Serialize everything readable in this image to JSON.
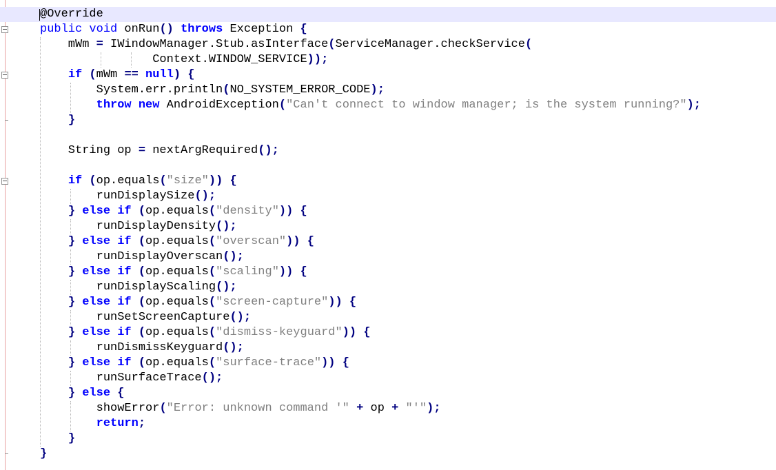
{
  "editor": {
    "lines": [
      [
        [
          "an",
          "@Override"
        ]
      ],
      [
        [
          "kw",
          "public"
        ],
        [
          "pl",
          " "
        ],
        [
          "kw",
          "void"
        ],
        [
          "pl",
          " onRun"
        ],
        [
          "op",
          "()"
        ],
        [
          "pl",
          " "
        ],
        [
          "kwb",
          "throws"
        ],
        [
          "pl",
          " Exception "
        ],
        [
          "op",
          "{"
        ]
      ],
      [
        [
          "pl",
          "    mWm "
        ],
        [
          "op",
          "="
        ],
        [
          "pl",
          " IWindowManager.Stub.asInterface"
        ],
        [
          "op",
          "("
        ],
        [
          "pl",
          "ServiceManager.checkService"
        ],
        [
          "op",
          "("
        ]
      ],
      [
        [
          "pl",
          "                Context.WINDOW_SERVICE"
        ],
        [
          "op",
          "));"
        ]
      ],
      [
        [
          "pl",
          "    "
        ],
        [
          "kwb",
          "if"
        ],
        [
          "pl",
          " "
        ],
        [
          "op",
          "("
        ],
        [
          "pl",
          "mWm "
        ],
        [
          "op",
          "=="
        ],
        [
          "pl",
          " "
        ],
        [
          "kwb",
          "null"
        ],
        [
          "op",
          ")"
        ],
        [
          "pl",
          " "
        ],
        [
          "op",
          "{"
        ]
      ],
      [
        [
          "pl",
          "        System.err.println"
        ],
        [
          "op",
          "("
        ],
        [
          "pl",
          "NO_SYSTEM_ERROR_CODE"
        ],
        [
          "op",
          ");"
        ]
      ],
      [
        [
          "pl",
          "        "
        ],
        [
          "kwb",
          "throw"
        ],
        [
          "pl",
          " "
        ],
        [
          "kwb",
          "new"
        ],
        [
          "pl",
          " AndroidException"
        ],
        [
          "op",
          "("
        ],
        [
          "str",
          "\"Can't connect to window manager; is the system running?\""
        ],
        [
          "op",
          ");"
        ]
      ],
      [
        [
          "pl",
          "    "
        ],
        [
          "op",
          "}"
        ]
      ],
      [],
      [
        [
          "pl",
          "    String op "
        ],
        [
          "op",
          "="
        ],
        [
          "pl",
          " nextArgRequired"
        ],
        [
          "op",
          "();"
        ]
      ],
      [],
      [
        [
          "pl",
          "    "
        ],
        [
          "kwb",
          "if"
        ],
        [
          "pl",
          " "
        ],
        [
          "op",
          "("
        ],
        [
          "pl",
          "op.equals"
        ],
        [
          "op",
          "("
        ],
        [
          "str",
          "\"size\""
        ],
        [
          "op",
          "))"
        ],
        [
          "pl",
          " "
        ],
        [
          "op",
          "{"
        ]
      ],
      [
        [
          "pl",
          "        runDisplaySize"
        ],
        [
          "op",
          "();"
        ]
      ],
      [
        [
          "pl",
          "    "
        ],
        [
          "op",
          "}"
        ],
        [
          "pl",
          " "
        ],
        [
          "kwb",
          "else"
        ],
        [
          "pl",
          " "
        ],
        [
          "kwb",
          "if"
        ],
        [
          "pl",
          " "
        ],
        [
          "op",
          "("
        ],
        [
          "pl",
          "op.equals"
        ],
        [
          "op",
          "("
        ],
        [
          "str",
          "\"density\""
        ],
        [
          "op",
          "))"
        ],
        [
          "pl",
          " "
        ],
        [
          "op",
          "{"
        ]
      ],
      [
        [
          "pl",
          "        runDisplayDensity"
        ],
        [
          "op",
          "();"
        ]
      ],
      [
        [
          "pl",
          "    "
        ],
        [
          "op",
          "}"
        ],
        [
          "pl",
          " "
        ],
        [
          "kwb",
          "else"
        ],
        [
          "pl",
          " "
        ],
        [
          "kwb",
          "if"
        ],
        [
          "pl",
          " "
        ],
        [
          "op",
          "("
        ],
        [
          "pl",
          "op.equals"
        ],
        [
          "op",
          "("
        ],
        [
          "str",
          "\"overscan\""
        ],
        [
          "op",
          "))"
        ],
        [
          "pl",
          " "
        ],
        [
          "op",
          "{"
        ]
      ],
      [
        [
          "pl",
          "        runDisplayOverscan"
        ],
        [
          "op",
          "();"
        ]
      ],
      [
        [
          "pl",
          "    "
        ],
        [
          "op",
          "}"
        ],
        [
          "pl",
          " "
        ],
        [
          "kwb",
          "else"
        ],
        [
          "pl",
          " "
        ],
        [
          "kwb",
          "if"
        ],
        [
          "pl",
          " "
        ],
        [
          "op",
          "("
        ],
        [
          "pl",
          "op.equals"
        ],
        [
          "op",
          "("
        ],
        [
          "str",
          "\"scaling\""
        ],
        [
          "op",
          "))"
        ],
        [
          "pl",
          " "
        ],
        [
          "op",
          "{"
        ]
      ],
      [
        [
          "pl",
          "        runDisplayScaling"
        ],
        [
          "op",
          "();"
        ]
      ],
      [
        [
          "pl",
          "    "
        ],
        [
          "op",
          "}"
        ],
        [
          "pl",
          " "
        ],
        [
          "kwb",
          "else"
        ],
        [
          "pl",
          " "
        ],
        [
          "kwb",
          "if"
        ],
        [
          "pl",
          " "
        ],
        [
          "op",
          "("
        ],
        [
          "pl",
          "op.equals"
        ],
        [
          "op",
          "("
        ],
        [
          "str",
          "\"screen-capture\""
        ],
        [
          "op",
          "))"
        ],
        [
          "pl",
          " "
        ],
        [
          "op",
          "{"
        ]
      ],
      [
        [
          "pl",
          "        runSetScreenCapture"
        ],
        [
          "op",
          "();"
        ]
      ],
      [
        [
          "pl",
          "    "
        ],
        [
          "op",
          "}"
        ],
        [
          "pl",
          " "
        ],
        [
          "kwb",
          "else"
        ],
        [
          "pl",
          " "
        ],
        [
          "kwb",
          "if"
        ],
        [
          "pl",
          " "
        ],
        [
          "op",
          "("
        ],
        [
          "pl",
          "op.equals"
        ],
        [
          "op",
          "("
        ],
        [
          "str",
          "\"dismiss-keyguard\""
        ],
        [
          "op",
          "))"
        ],
        [
          "pl",
          " "
        ],
        [
          "op",
          "{"
        ]
      ],
      [
        [
          "pl",
          "        runDismissKeyguard"
        ],
        [
          "op",
          "();"
        ]
      ],
      [
        [
          "pl",
          "    "
        ],
        [
          "op",
          "}"
        ],
        [
          "pl",
          " "
        ],
        [
          "kwb",
          "else"
        ],
        [
          "pl",
          " "
        ],
        [
          "kwb",
          "if"
        ],
        [
          "pl",
          " "
        ],
        [
          "op",
          "("
        ],
        [
          "pl",
          "op.equals"
        ],
        [
          "op",
          "("
        ],
        [
          "str",
          "\"surface-trace\""
        ],
        [
          "op",
          "))"
        ],
        [
          "pl",
          " "
        ],
        [
          "op",
          "{"
        ]
      ],
      [
        [
          "pl",
          "        runSurfaceTrace"
        ],
        [
          "op",
          "();"
        ]
      ],
      [
        [
          "pl",
          "    "
        ],
        [
          "op",
          "}"
        ],
        [
          "pl",
          " "
        ],
        [
          "kwb",
          "else"
        ],
        [
          "pl",
          " "
        ],
        [
          "op",
          "{"
        ]
      ],
      [
        [
          "pl",
          "        showError"
        ],
        [
          "op",
          "("
        ],
        [
          "str",
          "\"Error: unknown command '\""
        ],
        [
          "pl",
          " "
        ],
        [
          "op",
          "+"
        ],
        [
          "pl",
          " op "
        ],
        [
          "op",
          "+"
        ],
        [
          "pl",
          " "
        ],
        [
          "str",
          "\"'\""
        ],
        [
          "op",
          ");"
        ]
      ],
      [
        [
          "pl",
          "        "
        ],
        [
          "kwb",
          "return"
        ],
        [
          "op",
          ";"
        ]
      ],
      [
        [
          "pl",
          "    "
        ],
        [
          "op",
          "}"
        ]
      ],
      [
        [
          "op",
          "}"
        ]
      ]
    ]
  }
}
